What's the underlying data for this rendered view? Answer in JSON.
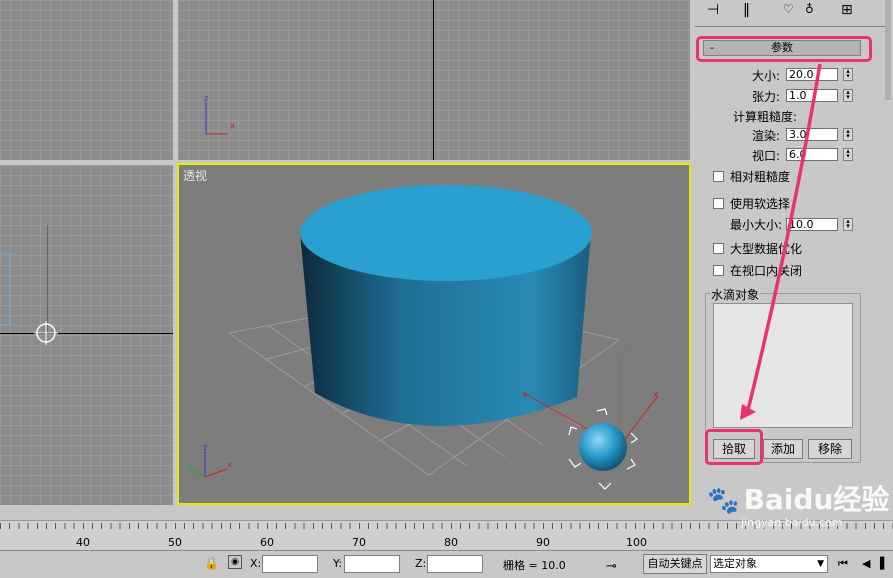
{
  "viewports": {
    "perspective_label": "透视"
  },
  "panel": {
    "rollout_title": "参数",
    "rollout_toggle": "-",
    "size_label": "大小:",
    "size_value": "20.0",
    "tension_label": "张力:",
    "tension_value": "1.0",
    "roughness_label": "计算粗糙度:",
    "render_label": "渲染:",
    "render_value": "3.0",
    "viewport_label": "视口:",
    "viewport_value": "6.0",
    "relative_roughness": "相对粗糙度",
    "use_soft_select": "使用软选择",
    "min_size_label": "最小大小:",
    "min_size_value": "10.0",
    "large_data_opt": "大型数据优化",
    "close_in_viewport": "在视口内关闭",
    "water_objects_label": "水滴对象",
    "pick_button": "拾取",
    "add_button": "添加",
    "remove_button": "移除"
  },
  "timeline": {
    "ticks": [
      "40",
      "50",
      "60",
      "70",
      "80",
      "90",
      "100"
    ]
  },
  "status": {
    "x_label": "X:",
    "y_label": "Y:",
    "z_label": "Z:",
    "grid_text": "栅格 = 10.0",
    "auto_key": "自动关键点",
    "selection_value": "选定对象"
  },
  "watermark": {
    "brand": "Baidu经验",
    "url": "jingyan.baidu.com"
  },
  "colors": {
    "highlight": "#e8346a",
    "object": "#2a9bcc",
    "viewport_border": "#e8e800"
  }
}
